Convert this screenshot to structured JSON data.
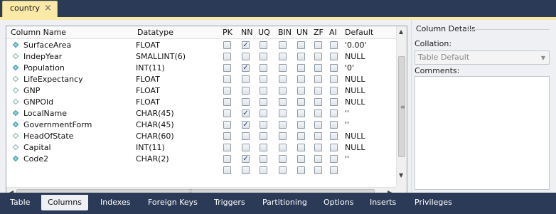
{
  "editor_tab": {
    "title": "country",
    "close_glyph": "×"
  },
  "grid": {
    "headers": [
      "Column Name",
      "Datatype",
      "PK",
      "NN",
      "UQ",
      "BIN",
      "UN",
      "ZF",
      "AI",
      "Default"
    ],
    "rows": [
      {
        "name": "SurfaceArea",
        "datatype": "FLOAT",
        "icon": "filled",
        "pk": false,
        "nn": true,
        "uq": false,
        "bin": false,
        "un": false,
        "zf": false,
        "ai": false,
        "default": "'0.00'"
      },
      {
        "name": "IndepYear",
        "datatype": "SMALLINT(6)",
        "icon": "hollow",
        "pk": false,
        "nn": false,
        "uq": false,
        "bin": false,
        "un": false,
        "zf": false,
        "ai": false,
        "default": "NULL"
      },
      {
        "name": "Population",
        "datatype": "INT(11)",
        "icon": "filled",
        "pk": false,
        "nn": true,
        "uq": false,
        "bin": false,
        "un": false,
        "zf": false,
        "ai": false,
        "default": "'0'"
      },
      {
        "name": "LifeExpectancy",
        "datatype": "FLOAT",
        "icon": "hollow",
        "pk": false,
        "nn": false,
        "uq": false,
        "bin": false,
        "un": false,
        "zf": false,
        "ai": false,
        "default": "NULL"
      },
      {
        "name": "GNP",
        "datatype": "FLOAT",
        "icon": "hollow",
        "pk": false,
        "nn": false,
        "uq": false,
        "bin": false,
        "un": false,
        "zf": false,
        "ai": false,
        "default": "NULL"
      },
      {
        "name": "GNPOld",
        "datatype": "FLOAT",
        "icon": "hollow",
        "pk": false,
        "nn": false,
        "uq": false,
        "bin": false,
        "un": false,
        "zf": false,
        "ai": false,
        "default": "NULL"
      },
      {
        "name": "LocalName",
        "datatype": "CHAR(45)",
        "icon": "filled",
        "pk": false,
        "nn": true,
        "uq": false,
        "bin": false,
        "un": false,
        "zf": false,
        "ai": false,
        "default": "''"
      },
      {
        "name": "GovernmentForm",
        "datatype": "CHAR(45)",
        "icon": "filled",
        "pk": false,
        "nn": true,
        "uq": false,
        "bin": false,
        "un": false,
        "zf": false,
        "ai": false,
        "default": "''"
      },
      {
        "name": "HeadOfState",
        "datatype": "CHAR(60)",
        "icon": "hollow",
        "pk": false,
        "nn": false,
        "uq": false,
        "bin": false,
        "un": false,
        "zf": false,
        "ai": false,
        "default": "NULL"
      },
      {
        "name": "Capital",
        "datatype": "INT(11)",
        "icon": "hollow",
        "pk": false,
        "nn": false,
        "uq": false,
        "bin": false,
        "un": false,
        "zf": false,
        "ai": false,
        "default": "NULL"
      },
      {
        "name": "Code2",
        "datatype": "CHAR(2)",
        "icon": "filled",
        "pk": false,
        "nn": true,
        "uq": false,
        "bin": false,
        "un": false,
        "zf": false,
        "ai": false,
        "default": "''"
      },
      {
        "name": "",
        "datatype": "",
        "icon": "none",
        "pk": false,
        "nn": false,
        "uq": false,
        "bin": false,
        "un": false,
        "zf": false,
        "ai": false,
        "default": ""
      }
    ]
  },
  "details": {
    "title": "Column Details",
    "collation_label": "Collation:",
    "collation_value": "Table Default",
    "comments_label": "Comments:"
  },
  "bottom_tabs": {
    "active": "Columns",
    "items": [
      "Table",
      "Columns",
      "Indexes",
      "Foreign Keys",
      "Triggers",
      "Partitioning",
      "Options",
      "Inserts",
      "Privileges"
    ]
  },
  "colors": {
    "accent_tab": "#fbe9a8",
    "frame": "#2b3a57",
    "panel": "#eef0f3"
  }
}
